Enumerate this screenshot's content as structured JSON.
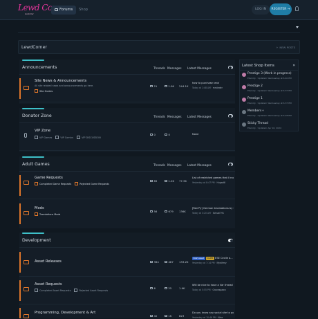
{
  "header": {
    "logo_text": "Lewd Corner",
    "logo_sub": "lewdcorner",
    "nav_forums": "Forums",
    "nav_shop": "Shop",
    "login": "LOG IN",
    "register": "REGISTER →"
  },
  "breadcrumb": {
    "title": "LewdCorner",
    "new_posts": "NEW POSTS"
  },
  "columns": {
    "threads": "Threads",
    "messages": "Messages",
    "latest": "Latest Messages"
  },
  "sections": [
    {
      "title": "Announcements",
      "nodes": [
        {
          "name": "Site News & Announcements",
          "desc": "All site related news and announcements go here.",
          "subs": [
            "Site Guides"
          ],
          "threads": "21",
          "messages": "1.9K",
          "msgs_extra": "244.1K",
          "latest": "how to purchase rank",
          "latest_time": "Today at 1:48 AM",
          "latest_user": "mrsteder"
        }
      ]
    },
    {
      "title": "Donator Zone",
      "nodes": [
        {
          "name": "VIP Zone",
          "subs": [
            "VIP Games",
            "VIP Comics",
            "VIP DISCUSSION"
          ],
          "threads": "0",
          "messages": "0",
          "latest": "None"
        }
      ]
    },
    {
      "title": "Adult Games",
      "nodes": [
        {
          "name": "Game Requests",
          "subs": [
            "Completed Game Requests",
            "Rejected Game Requests"
          ],
          "threads": "89",
          "messages": "1.2K",
          "msgs_extra": "77.3K",
          "latest": "List of restricted games that I kno...",
          "latest_time": "Yesterday at 8:47 PM",
          "latest_user": "Hugadill"
        },
        {
          "name": "Mods",
          "subs": [
            "Translations Mods"
          ],
          "threads": "56",
          "messages": "679",
          "msgs_extra": "136K",
          "latest": "[Ren'Py] German translations by S...",
          "latest_time": "Today at 3:20 AM",
          "latest_user": "Schubi791"
        }
      ]
    },
    {
      "title": "Development",
      "nodes": [
        {
          "name": "Asset Releases",
          "threads": "364",
          "messages": "487",
          "msgs_extra": "133.2K",
          "badge1": "DAZ Asset",
          "badge2": "Outfit",
          "latest": "ESE Cecile a...",
          "latest_time": "Yesterday at 7:14 PM",
          "latest_user": "Mysthmy"
        },
        {
          "name": "Asset Requests",
          "subs": [
            "Completed Asset Requests",
            "Rejected Asset Requests"
          ],
          "threads": "6",
          "messages": "25",
          "msgs_extra": "1.9K",
          "latest": "Will be nice to have a Var thread ?",
          "latest_time": "Today at 5:55 PM",
          "latest_user": "Gravespawn"
        },
        {
          "name": "Programming, Development & Art",
          "threads": "40",
          "messages": "1K",
          "msgs_extra": "823",
          "latest": "Do you know any social site to po...",
          "latest_time": "Yesterday at 10:46 PM",
          "latest_user": "Ninz"
        }
      ]
    }
  ],
  "shop": {
    "title": "Latest Shop Items",
    "items": [
      {
        "name": "Prestige 3 (Work in progress)",
        "meta": "Eternity · Updated: Wednesday at 6:40 PM"
      },
      {
        "name": "Prestige 2",
        "meta": "Eternity · Updated: Wednesday at 6:37 PM"
      },
      {
        "name": "Prestige 1",
        "meta": "Eternity · Updated: Wednesday at 6:37 PM"
      },
      {
        "name": "Members+",
        "meta": "Eternity · Updated: Wednesday at 6:28 PM"
      },
      {
        "name": "Sticky Thread",
        "meta": "Eternity · Updated: Apr 16, 2024"
      }
    ]
  }
}
